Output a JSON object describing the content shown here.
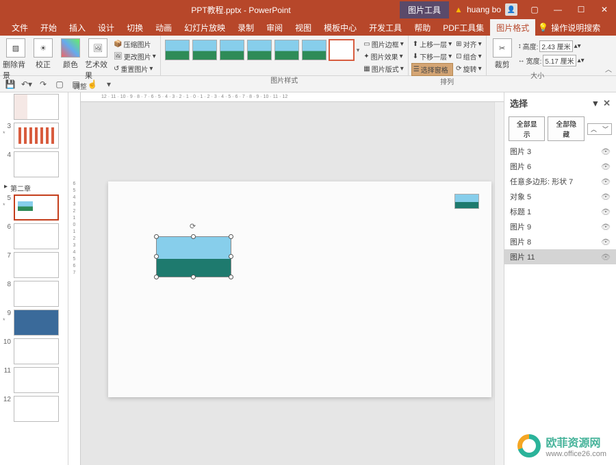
{
  "title": "PPT教程.pptx - PowerPoint",
  "context_tab": "图片工具",
  "user_name": "huang bo",
  "tabs": [
    "文件",
    "开始",
    "插入",
    "设计",
    "切换",
    "动画",
    "幻灯片放映",
    "录制",
    "审阅",
    "视图",
    "模板中心",
    "开发工具",
    "帮助",
    "PDF工具集",
    "图片格式"
  ],
  "active_tab": 14,
  "tell_me": "操作说明搜索",
  "ribbon": {
    "adjust": {
      "remove_bg": "删除背景",
      "corrections": "校正",
      "color": "颜色",
      "artistic": "艺术效果",
      "compress": "压缩图片",
      "change": "更改图片",
      "reset": "重置图片",
      "label": "调整"
    },
    "styles": {
      "border": "图片边框",
      "effects": "图片效果",
      "layout": "图片版式",
      "label": "图片样式"
    },
    "arrange": {
      "forward": "上移一层",
      "backward": "下移一层",
      "selection_pane": "选择窗格",
      "align": "对齐",
      "group": "组合",
      "rotate": "旋转",
      "label": "排列"
    },
    "size": {
      "crop": "裁剪",
      "height_lbl": "高度:",
      "height_val": "2.43 厘米",
      "width_lbl": "宽度:",
      "width_val": "5.17 厘米",
      "label": "大小"
    }
  },
  "section_label": "第二章",
  "slide_nums": [
    "3",
    "4",
    "5",
    "6",
    "7",
    "8",
    "9",
    "10",
    "11",
    "12"
  ],
  "ruler_h": [
    "12",
    "11",
    "10",
    "9",
    "8",
    "7",
    "6",
    "5",
    "4",
    "3",
    "2",
    "1",
    "0",
    "1",
    "2",
    "3",
    "4",
    "5",
    "6",
    "7",
    "8",
    "9",
    "10",
    "11",
    "12"
  ],
  "ruler_v": [
    "6",
    "5",
    "4",
    "3",
    "2",
    "1",
    "0",
    "1",
    "2",
    "3",
    "4",
    "5",
    "6",
    "7"
  ],
  "pane": {
    "title": "选择",
    "show_all": "全部显示",
    "hide_all": "全部隐藏",
    "items": [
      "图片 3",
      "图片 6",
      "任意多边形: 形状 7",
      "对象 5",
      "标题 1",
      "图片 9",
      "图片 8",
      "图片 11"
    ],
    "selected": 7
  },
  "watermark": {
    "name": "欧菲资源网",
    "url": "www.office26.com"
  }
}
